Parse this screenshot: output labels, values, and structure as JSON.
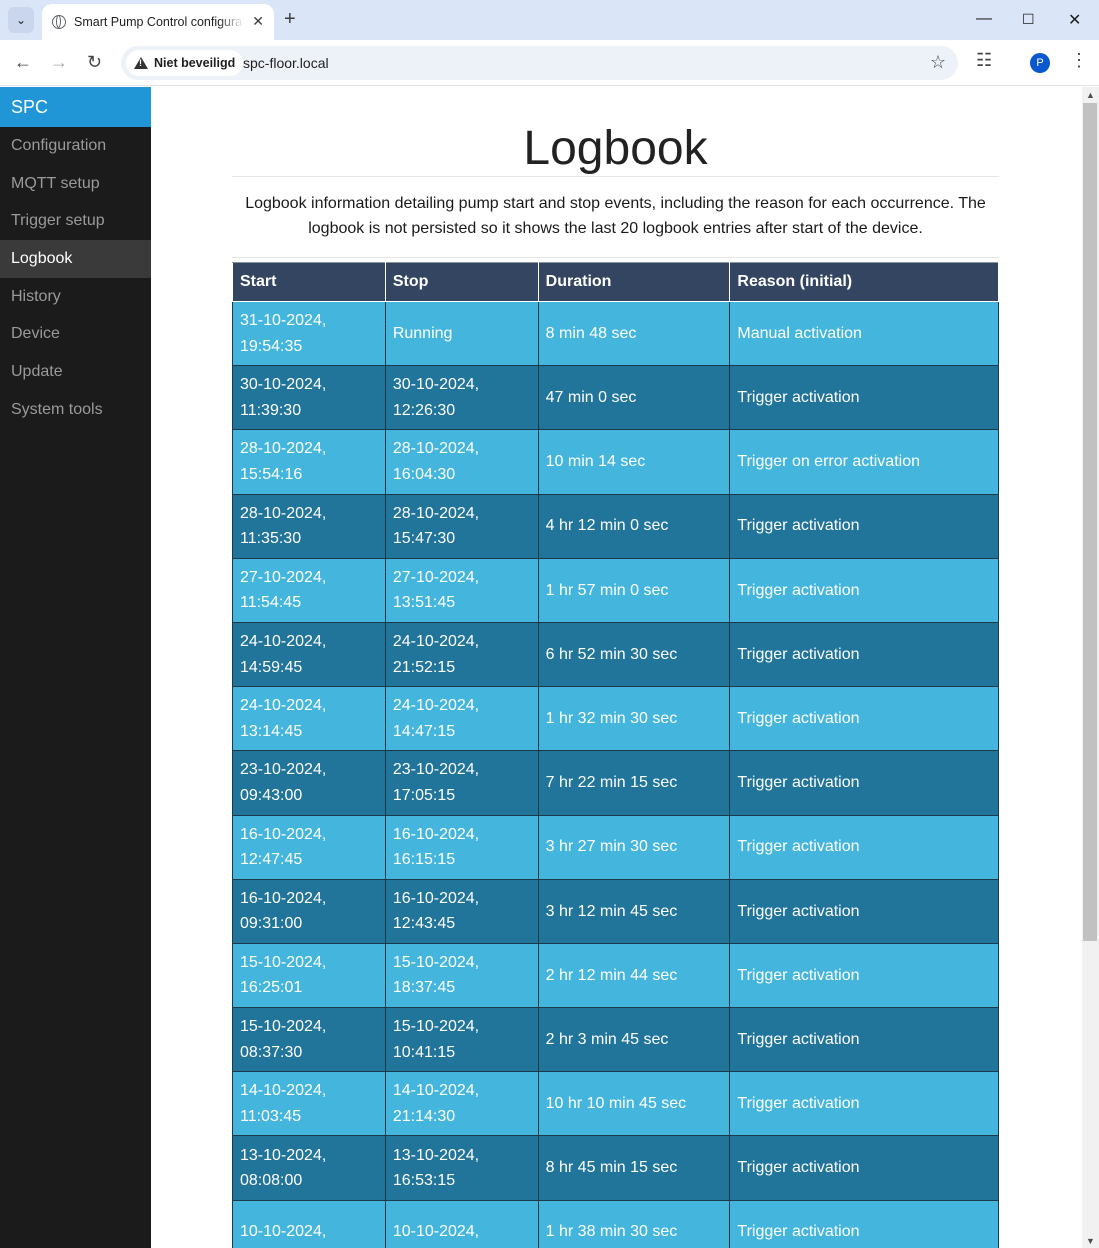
{
  "browser": {
    "tab_title": "Smart Pump Control configuration",
    "new_tab": "+",
    "security_label": "Niet beveiligd",
    "url": "spc-floor.local",
    "profile_initial": "P"
  },
  "sidebar": {
    "brand": "SPC",
    "items": [
      {
        "label": "Configuration"
      },
      {
        "label": "MQTT setup"
      },
      {
        "label": "Trigger setup"
      },
      {
        "label": "Logbook"
      },
      {
        "label": "History"
      },
      {
        "label": "Device"
      },
      {
        "label": "Update"
      },
      {
        "label": "System tools"
      }
    ],
    "active": "Logbook"
  },
  "page": {
    "title": "Logbook",
    "description": "Logbook information detailing pump start and stop events, including the reason for each occurrence. The logbook is not persisted so it shows the last 20 logbook entries after start of the device."
  },
  "table": {
    "headers": [
      "Start",
      "Stop",
      "Duration",
      "Reason (initial)"
    ],
    "rows": [
      {
        "start_date": "31-10-2024,",
        "start_time": "19:54:35",
        "stop_date": "Running",
        "stop_time": "",
        "duration": "8 min 48 sec",
        "reason": "Manual activation"
      },
      {
        "start_date": "30-10-2024,",
        "start_time": "11:39:30",
        "stop_date": "30-10-2024,",
        "stop_time": "12:26:30",
        "duration": "47 min 0 sec",
        "reason": "Trigger activation"
      },
      {
        "start_date": "28-10-2024,",
        "start_time": "15:54:16",
        "stop_date": "28-10-2024,",
        "stop_time": "16:04:30",
        "duration": "10 min 14 sec",
        "reason": "Trigger on error activation"
      },
      {
        "start_date": "28-10-2024,",
        "start_time": "11:35:30",
        "stop_date": "28-10-2024,",
        "stop_time": "15:47:30",
        "duration": "4 hr 12 min 0 sec",
        "reason": "Trigger activation"
      },
      {
        "start_date": "27-10-2024,",
        "start_time": "11:54:45",
        "stop_date": "27-10-2024,",
        "stop_time": "13:51:45",
        "duration": "1 hr 57 min 0 sec",
        "reason": "Trigger activation"
      },
      {
        "start_date": "24-10-2024,",
        "start_time": "14:59:45",
        "stop_date": "24-10-2024,",
        "stop_time": "21:52:15",
        "duration": "6 hr 52 min 30 sec",
        "reason": "Trigger activation"
      },
      {
        "start_date": "24-10-2024,",
        "start_time": "13:14:45",
        "stop_date": "24-10-2024,",
        "stop_time": "14:47:15",
        "duration": "1 hr 32 min 30 sec",
        "reason": "Trigger activation"
      },
      {
        "start_date": "23-10-2024,",
        "start_time": "09:43:00",
        "stop_date": "23-10-2024,",
        "stop_time": "17:05:15",
        "duration": "7 hr 22 min 15 sec",
        "reason": "Trigger activation"
      },
      {
        "start_date": "16-10-2024,",
        "start_time": "12:47:45",
        "stop_date": "16-10-2024,",
        "stop_time": "16:15:15",
        "duration": "3 hr 27 min 30 sec",
        "reason": "Trigger activation"
      },
      {
        "start_date": "16-10-2024,",
        "start_time": "09:31:00",
        "stop_date": "16-10-2024,",
        "stop_time": "12:43:45",
        "duration": "3 hr 12 min 45 sec",
        "reason": "Trigger activation"
      },
      {
        "start_date": "15-10-2024,",
        "start_time": "16:25:01",
        "stop_date": "15-10-2024,",
        "stop_time": "18:37:45",
        "duration": "2 hr 12 min 44 sec",
        "reason": "Trigger activation"
      },
      {
        "start_date": "15-10-2024,",
        "start_time": "08:37:30",
        "stop_date": "15-10-2024,",
        "stop_time": "10:41:15",
        "duration": "2 hr 3 min 45 sec",
        "reason": "Trigger activation"
      },
      {
        "start_date": "14-10-2024,",
        "start_time": "11:03:45",
        "stop_date": "14-10-2024,",
        "stop_time": "21:14:30",
        "duration": "10 hr 10 min 45 sec",
        "reason": "Trigger activation"
      },
      {
        "start_date": "13-10-2024,",
        "start_time": "08:08:00",
        "stop_date": "13-10-2024,",
        "stop_time": "16:53:15",
        "duration": "8 hr 45 min 15 sec",
        "reason": "Trigger activation"
      },
      {
        "start_date": "10-10-2024,",
        "start_time": "",
        "stop_date": "10-10-2024,",
        "stop_time": "",
        "duration": "1 hr 38 min 30 sec",
        "reason": "Trigger activation"
      }
    ]
  },
  "colors": {
    "sidebar_bg": "#1b1b1b",
    "brand_bg": "#2196d6",
    "header_bg": "#344561",
    "row_light": "#44b6dd",
    "row_dark": "#21749a"
  }
}
